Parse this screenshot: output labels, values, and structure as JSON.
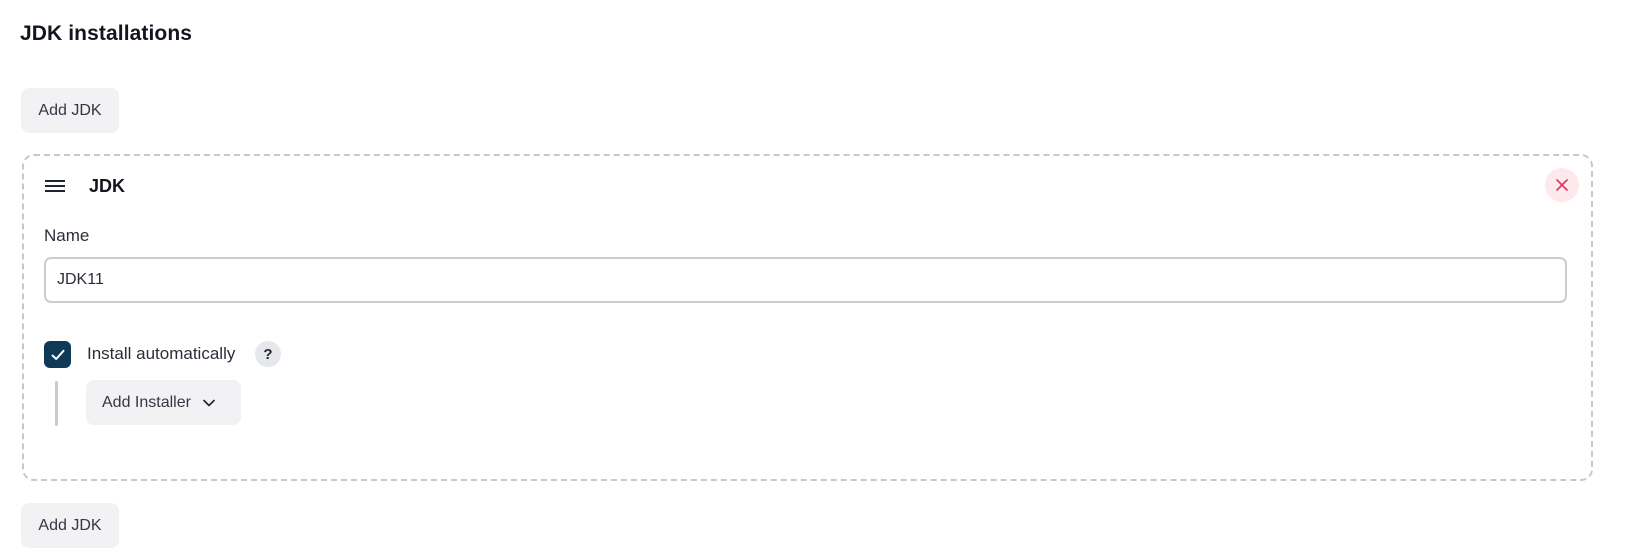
{
  "section": {
    "title": "JDK installations"
  },
  "buttons": {
    "add_jdk_top": "Add JDK",
    "add_jdk_bottom": "Add JDK"
  },
  "card": {
    "title": "JDK",
    "close_icon": "close-icon",
    "drag_icon": "drag-handle-icon",
    "name_label": "Name",
    "name_value": "JDK11",
    "install_auto": {
      "label": "Install automatically",
      "checked": true,
      "help_label": "?"
    },
    "add_installer_label": "Add Installer",
    "add_installer_icon": "chevron-down-icon"
  },
  "colors": {
    "checkbox_fill": "#0e3957",
    "close_bg": "#fde8ec",
    "close_x": "#d9365a",
    "button_bg": "#f2f2f5"
  }
}
